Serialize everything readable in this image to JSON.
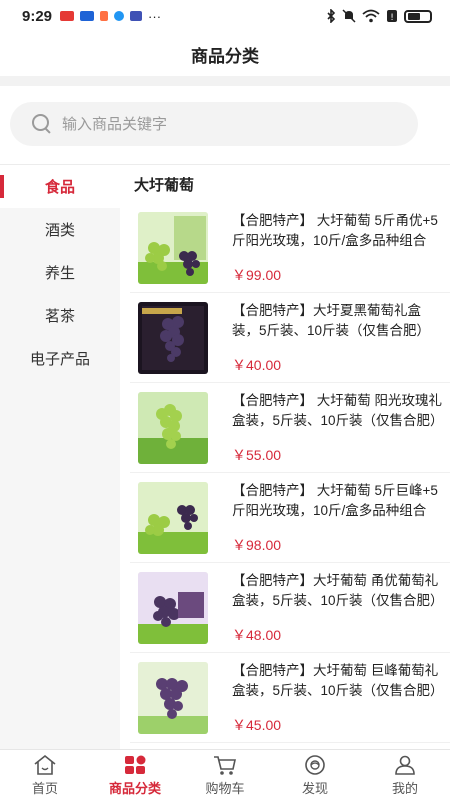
{
  "status_bar": {
    "time": "9:29",
    "more": "···"
  },
  "header": {
    "title": "商品分类"
  },
  "search": {
    "placeholder": "输入商品关键字"
  },
  "sidebar": {
    "items": [
      {
        "label": "食品",
        "active": true
      },
      {
        "label": "酒类",
        "active": false
      },
      {
        "label": "养生",
        "active": false
      },
      {
        "label": "茗茶",
        "active": false
      },
      {
        "label": "电子产品",
        "active": false
      }
    ]
  },
  "content": {
    "section_title": "大圩葡萄",
    "products": [
      {
        "name": "【合肥特产】 大圩葡萄 5斤甬优+5斤阳光玫瑰，10斤/盒多品种组合",
        "price": "￥99.00"
      },
      {
        "name": "【合肥特产】大圩夏黑葡萄礼盒装，5斤装、10斤装（仅售合肥）",
        "price": "￥40.00"
      },
      {
        "name": "【合肥特产】 大圩葡萄 阳光玫瑰礼盒装，5斤装、10斤装（仅售合肥）",
        "price": "￥55.00"
      },
      {
        "name": "【合肥特产】 大圩葡萄 5斤巨峰+5斤阳光玫瑰，10斤/盒多品种组合",
        "price": "￥98.00"
      },
      {
        "name": "【合肥特产】大圩葡萄 甬优葡萄礼盒装，5斤装、10斤装（仅售合肥）",
        "price": "￥48.00"
      },
      {
        "name": "【合肥特产】大圩葡萄 巨峰葡萄礼盒装，5斤装、10斤装（仅售合肥）",
        "price": "￥45.00"
      }
    ]
  },
  "tabbar": {
    "items": [
      {
        "label": "首页",
        "icon": "home-icon"
      },
      {
        "label": "商品分类",
        "icon": "category-icon"
      },
      {
        "label": "购物车",
        "icon": "cart-icon"
      },
      {
        "label": "发现",
        "icon": "discover-icon"
      },
      {
        "label": "我的",
        "icon": "profile-icon"
      }
    ]
  },
  "colors": {
    "accent": "#d6293a",
    "sidebar_bg": "#f6f6f6",
    "search_bg": "#f3f3f3"
  }
}
